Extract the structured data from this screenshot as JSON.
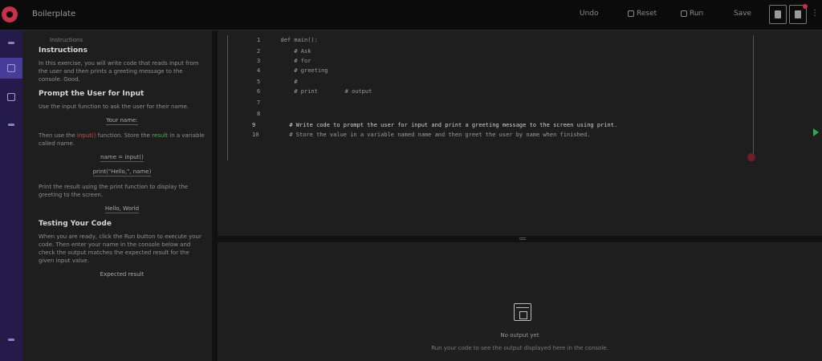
{
  "app": {
    "title": "Boilerplate"
  },
  "toolbar": {
    "items": [
      {
        "label": "Undo"
      },
      {
        "label": "Reset"
      },
      {
        "label": "Run"
      },
      {
        "label": "Save"
      }
    ]
  },
  "rail": {
    "items": [
      "files",
      "instructions",
      "search",
      "extensions",
      "settings"
    ]
  },
  "instructions": {
    "crumb": "Instructions",
    "heading1": "Instructions",
    "p1": "In this exercise, you will write code that reads input from the user and then prints a greeting message to the console.",
    "p1_tail": "Good.",
    "heading2": "Prompt the User for Input",
    "p2": "Use the input function to ask the user for their name.",
    "example1": "Your name:",
    "p3_a": "Then use the",
    "p3_red": "input()",
    "p3_b": "function. Store the",
    "p3_green": "result",
    "p3_c": "in a variable called name.",
    "example2": "name = input()",
    "example3": "print(\"Hello,\", name)",
    "p4": "Print the result using the print function to display the greeting to the screen.",
    "example4": "Hello, World",
    "heading3": "Testing Your Code",
    "p5": "When you are ready, click the Run button to execute your code. Then enter your name in the console below and check the output matches the expected result for the given input value.",
    "example5": "Expected result"
  },
  "editor": {
    "lines": [
      "1      def main():",
      "2          # Ask",
      "3          # for",
      "4          # greeting",
      "5          #",
      "6          # print        # output",
      "7",
      "8",
      "9          # Write code to prompt the user for input and print a greeting message to the screen using print.",
      "10         # Store the value in a variable named name and then greet the user by name when finished."
    ]
  },
  "output": {
    "title": "No output yet",
    "description": "Run your code to see the output displayed here in the console."
  }
}
